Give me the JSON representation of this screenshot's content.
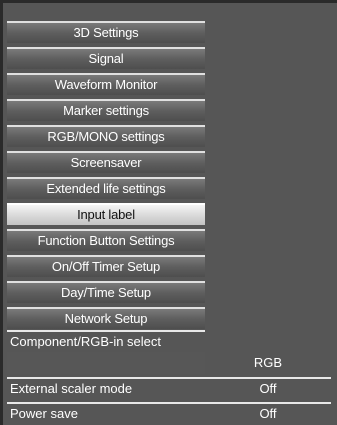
{
  "menu": {
    "items": [
      {
        "label": "3D Settings"
      },
      {
        "label": "Signal"
      },
      {
        "label": "Waveform Monitor"
      },
      {
        "label": "Marker settings"
      },
      {
        "label": "RGB/MONO settings"
      },
      {
        "label": "Screensaver"
      },
      {
        "label": "Extended life settings"
      },
      {
        "label": "Input label"
      },
      {
        "label": "Function Button Settings"
      },
      {
        "label": "On/Off Timer Setup"
      },
      {
        "label": "Day/Time Setup"
      },
      {
        "label": "Network Setup"
      }
    ],
    "selected_index": 7
  },
  "component_select": {
    "label": "Component/RGB-in select",
    "value": "RGB"
  },
  "external_scaler": {
    "label": "External scaler mode",
    "value": "Off"
  },
  "power_save": {
    "label": "Power save",
    "value": "Off"
  }
}
